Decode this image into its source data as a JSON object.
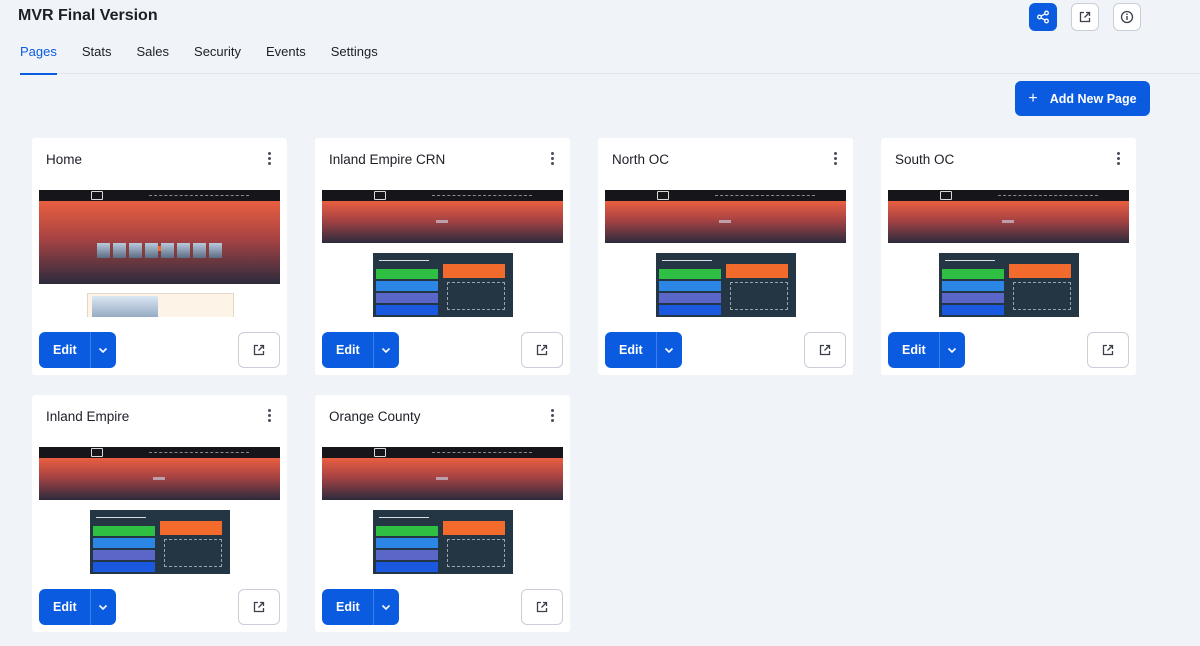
{
  "header": {
    "title": "MVR Final Version",
    "actions": [
      {
        "icon": "share-icon",
        "primary": true
      },
      {
        "icon": "external-link-icon",
        "primary": false
      },
      {
        "icon": "info-icon",
        "primary": false
      }
    ]
  },
  "tabs": [
    {
      "label": "Pages",
      "active": true
    },
    {
      "label": "Stats",
      "active": false
    },
    {
      "label": "Sales",
      "active": false
    },
    {
      "label": "Security",
      "active": false
    },
    {
      "label": "Events",
      "active": false
    },
    {
      "label": "Settings",
      "active": false
    }
  ],
  "toolbar": {
    "add_label": "Add New Page",
    "add_icon": "plus"
  },
  "cards": [
    {
      "title": "Home",
      "thumb": "home",
      "edit_label": "Edit"
    },
    {
      "title": "Inland Empire CRN",
      "thumb": "landing",
      "edit_label": "Edit"
    },
    {
      "title": "North OC",
      "thumb": "landing",
      "edit_label": "Edit"
    },
    {
      "title": "South OC",
      "thumb": "landing",
      "edit_label": "Edit"
    },
    {
      "title": "Inland Empire",
      "thumb": "landing",
      "edit_label": "Edit"
    },
    {
      "title": "Orange County",
      "thumb": "landing",
      "edit_label": "Edit"
    }
  ],
  "colors": {
    "accent": "#0a5be0",
    "background": "#f0f3f8"
  }
}
